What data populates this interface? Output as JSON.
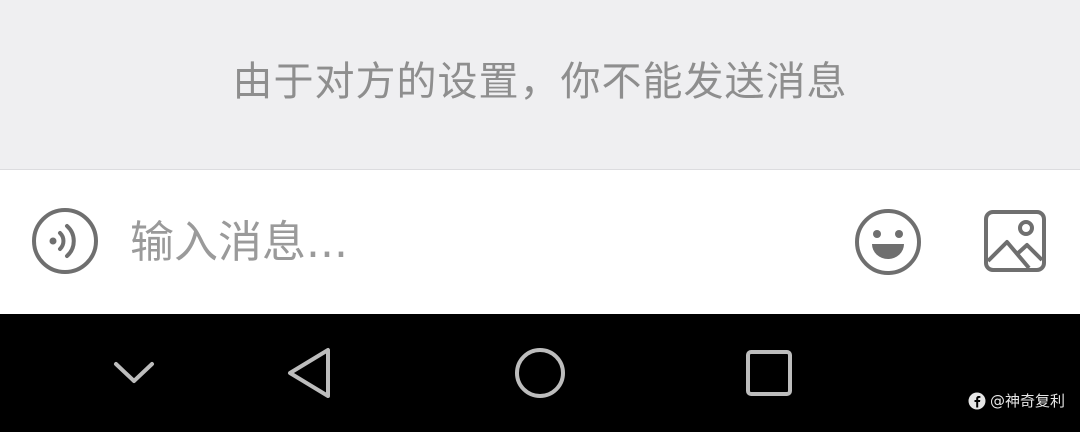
{
  "notice": {
    "text": "由于对方的设置，你不能发送消息"
  },
  "input_bar": {
    "placeholder": "输入消息...",
    "value": "",
    "voice_icon": "voice-wave-icon",
    "emoji_icon": "smiley-face-icon",
    "image_icon": "image-picture-icon"
  },
  "nav_bar": {
    "collapse_icon": "chevron-down-icon",
    "back_icon": "triangle-back-icon",
    "home_icon": "circle-home-icon",
    "recent_icon": "square-recent-icon"
  },
  "watermark": {
    "text": "@神奇复利"
  },
  "colors": {
    "notice_bg": "#efeff1",
    "notice_text": "#8e8e8e",
    "icon_gray": "#6f6f6f",
    "nav_bg": "#000000",
    "nav_icon": "#bdbdbd"
  }
}
